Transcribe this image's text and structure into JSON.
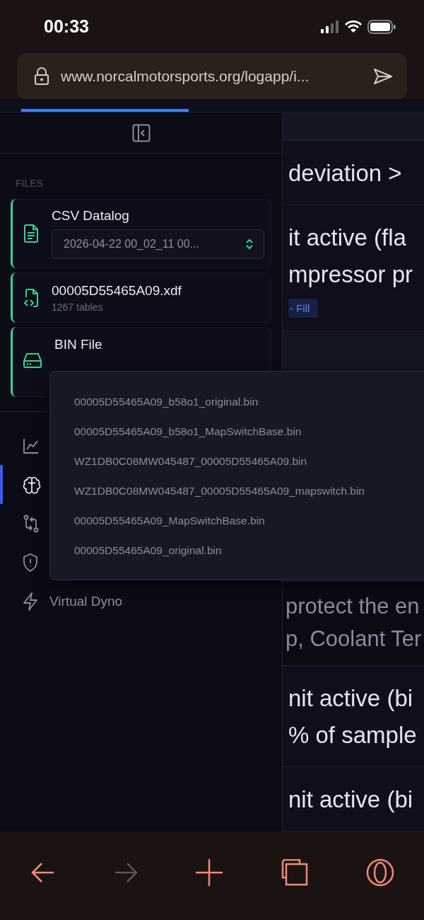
{
  "status_bar": {
    "time": "00:33"
  },
  "address_bar": {
    "url": "www.norcalmotorsports.org/logapp/i..."
  },
  "top_tabs": [
    {
      "selected": true
    }
  ],
  "sidebar": {
    "section_label": "FILES",
    "files": [
      {
        "kind": "datalog",
        "title": "CSV Datalog",
        "select_value": "2026-04-22 00_02_11 00..."
      },
      {
        "kind": "definition",
        "title": "00005D55465A09.xdf",
        "subtitle": "1267 tables"
      },
      {
        "kind": "binary",
        "title": "BIN File"
      }
    ],
    "nav": [
      {
        "selected": false
      },
      {
        "selected": true
      },
      {
        "selected": false
      },
      {
        "selected": false
      },
      {
        "label": "Virtual Dyno",
        "selected": false
      }
    ]
  },
  "bin_dropdown": {
    "options": [
      "00005D55465A09_b58o1_original.bin",
      "00005D55465A09_b58o1_MapSwitchBase.bin",
      "WZ1DB0C08MW045487_00005D55465A09.bin",
      "WZ1DB0C08MW045487_00005D55465A09_mapswitch.bin",
      "00005D55465A09_MapSwitchBase.bin",
      "00005D55465A09_original.bin"
    ]
  },
  "content": {
    "blocks": [
      {
        "kind": "heading",
        "lines": [
          "deviation >"
        ]
      },
      {
        "kind": "heading",
        "lines": [
          "it active (fla",
          "mpressor pr"
        ],
        "badge": "- Fill"
      },
      {
        "kind": "code"
      },
      {
        "kind": "panel"
      },
      {
        "kind": "muted",
        "lines": [
          "protect the en",
          "p, Coolant Ter"
        ]
      },
      {
        "kind": "heading",
        "lines": [
          "nit active (bi",
          "% of sample"
        ]
      },
      {
        "kind": "heading",
        "lines": [
          "nit active (bi"
        ]
      }
    ]
  },
  "toolbar": {
    "forward_disabled": true
  }
}
